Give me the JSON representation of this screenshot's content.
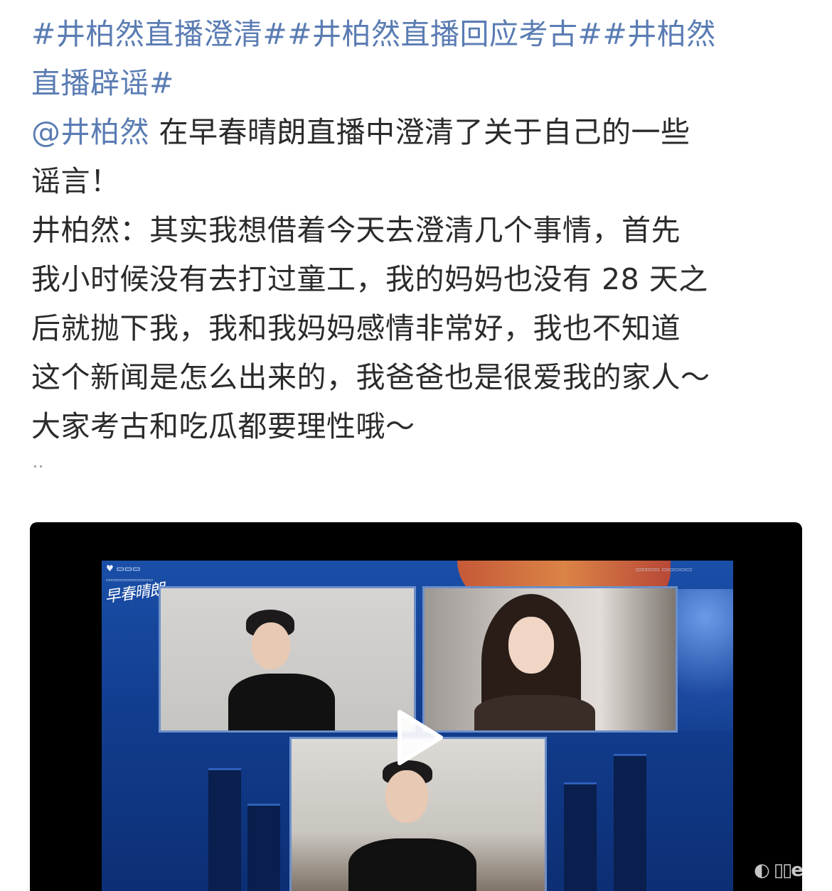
{
  "post": {
    "line1": {
      "hashtag": "#井柏然直播澄清##井柏然直播回应考古##井柏然"
    },
    "line2": {
      "hashtag": "直播辟谣#"
    },
    "line3": {
      "mention": "@井柏然",
      "text": " 在早春晴朗直播中澄清了关于自己的一些"
    },
    "line4": "谣言！",
    "line5": "井柏然：其实我想借着今天去澄清几个事情，首先",
    "line6": "我小时候没有去打过童工，我的妈妈也没有 28 天之",
    "line7": "后就抛下我，我和我妈妈感情非常好，我也不知道",
    "line8": "这个新闻是怎么出来的，我爸爸也是很爱我的家人～",
    "line9": "大家考古和吃瓜都要理性哦～"
  },
  "video": {
    "show_title": "早春晴朗",
    "play_icon": "play-icon",
    "colors": {
      "link": "#5a7cb3",
      "text": "#2b2b2b",
      "stream_bg": "#123d8f"
    }
  }
}
